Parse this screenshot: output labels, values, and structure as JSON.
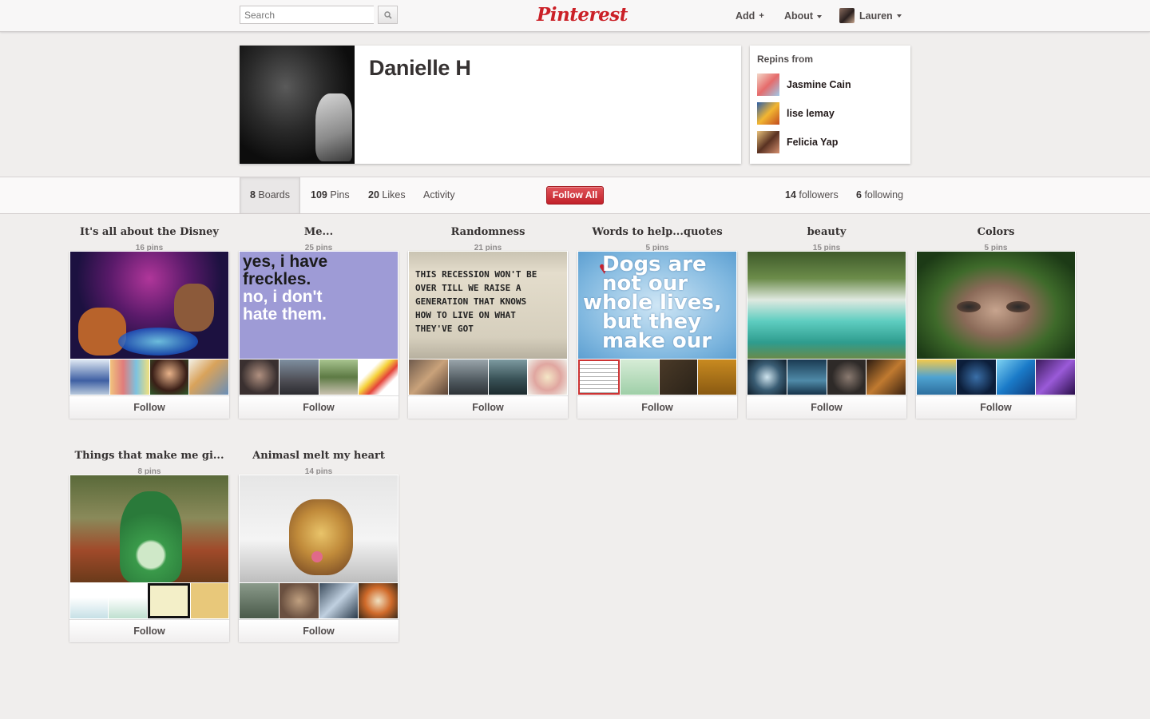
{
  "header": {
    "search_placeholder": "Search",
    "logo": "Pinterest",
    "add_label": "Add",
    "about_label": "About",
    "user_label": "Lauren"
  },
  "profile": {
    "name": "Danielle H"
  },
  "repins": {
    "title": "Repins from",
    "users": [
      {
        "name": "Jasmine Cain"
      },
      {
        "name": "lise lemay"
      },
      {
        "name": "Felicia Yap"
      }
    ]
  },
  "stats": {
    "boards_count": "8",
    "boards_label": "Boards",
    "pins_count": "109",
    "pins_label": "Pins",
    "likes_count": "20",
    "likes_label": "Likes",
    "activity_label": "Activity",
    "follow_all_label": "Follow All",
    "followers_count": "14",
    "followers_label": "followers",
    "following_count": "6",
    "following_label": "following"
  },
  "boards": [
    {
      "title": "It's all about the Disney",
      "count": "16 pins",
      "follow": "Follow"
    },
    {
      "title": "Me...",
      "count": "25 pins",
      "follow": "Follow",
      "cover_text": [
        "yes, i have",
        "freckles.",
        "no, i don't",
        "hate them."
      ]
    },
    {
      "title": "Randomness",
      "count": "21 pins",
      "follow": "Follow",
      "cover_text": [
        "THIS RECESSION WON'T BE",
        "OVER TILL WE RAISE A",
        "GENERATION THAT KNOWS",
        "HOW TO LIVE ON WHAT",
        "THEY'VE GOT"
      ]
    },
    {
      "title": "Words to help...quotes",
      "count": "5 pins",
      "follow": "Follow",
      "cover_text": [
        "Dogs are",
        "not our",
        "whole lives,",
        "but they",
        "make our"
      ]
    },
    {
      "title": "beauty",
      "count": "15 pins",
      "follow": "Follow"
    },
    {
      "title": "Colors",
      "count": "5 pins",
      "follow": "Follow"
    },
    {
      "title": "Things that make me gi...",
      "count": "8 pins",
      "follow": "Follow"
    },
    {
      "title": "Animasl melt my heart",
      "count": "14 pins",
      "follow": "Follow"
    }
  ],
  "colors": {
    "brand_red": "#cb2027",
    "background": "#f0eeed"
  }
}
